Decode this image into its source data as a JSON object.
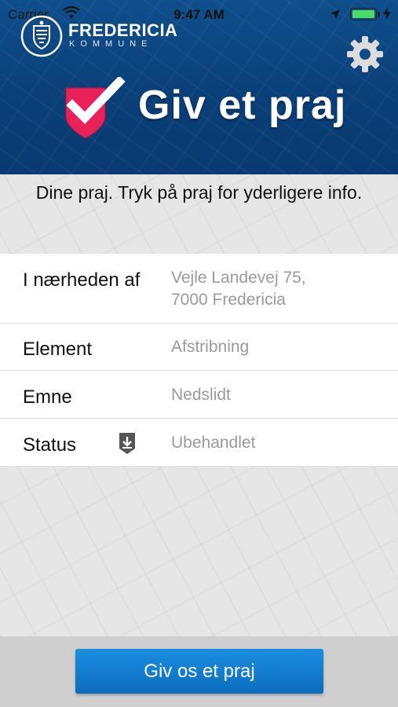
{
  "statusbar": {
    "carrier": "Carrier",
    "time": "9:47 AM",
    "icons": [
      "wifi-icon",
      "location-arrow-icon",
      "battery-icon",
      "charging-icon"
    ]
  },
  "header": {
    "org_name": "FREDERICIA",
    "org_sub": "KOMMUNE",
    "app_title": "Giv et praj",
    "settings_icon": "gear-icon",
    "brand_icon": "shield-checkmark-icon",
    "colors": {
      "header_bg": "#0b437e",
      "brand_shield": "#e8215a",
      "accent": "#1580d2"
    }
  },
  "main": {
    "subtitle": "Dine praj. Tryk på praj for yderligere info.",
    "details": [
      {
        "label": "I nærheden af",
        "value_line1": "Vejle Landevej 75,",
        "value_line2": "7000 Fredericia"
      },
      {
        "label": "Element",
        "value": "Afstribning"
      },
      {
        "label": "Emne",
        "value": "Nedslidt"
      },
      {
        "label": "Status",
        "value": "Ubehandlet",
        "icon": "download-tag-icon"
      }
    ]
  },
  "footer": {
    "cta_label": "Giv os et praj"
  }
}
